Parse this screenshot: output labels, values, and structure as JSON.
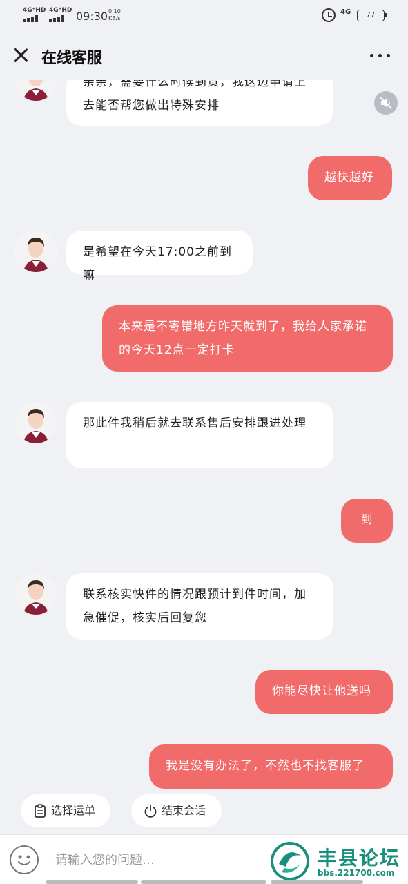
{
  "status_bar": {
    "sig1": "4G⁺HD",
    "sig2": "4G⁺HD",
    "time": "09:30",
    "speed_value": "0.10",
    "speed_unit": "KB/s",
    "network": "4G",
    "battery": "77"
  },
  "header": {
    "title": "在线客服"
  },
  "messages": [
    {
      "from": "agent",
      "text": "亲亲，需要什么时候到货，我这边申请上去能否帮您做出特殊安排"
    },
    {
      "from": "user",
      "text": "越快越好"
    },
    {
      "from": "agent",
      "text": "是希望在今天17:00之前到嘛"
    },
    {
      "from": "user",
      "text": "本来是不寄错地方昨天就到了，我给人家承诺的今天12点一定打卡"
    },
    {
      "from": "agent",
      "text": "那此件我稍后就去联系售后安排跟进处理"
    },
    {
      "from": "user",
      "text": "到"
    },
    {
      "from": "agent",
      "text": "联系核实快件的情况跟预计到件时间，加急催促，核实后回复您"
    },
    {
      "from": "user",
      "text": "你能尽快让他送吗"
    },
    {
      "from": "user",
      "text": "我是没有办法了，不然也不找客服了"
    }
  ],
  "actions": {
    "select_waybill": "选择运单",
    "end_session": "结束会话"
  },
  "input": {
    "placeholder": "请输入您的问题…"
  },
  "watermark": {
    "name": "丰县论坛",
    "url": "bbs.221700.com"
  },
  "icons": {
    "close": "close-icon",
    "more": "more-icon",
    "mute": "speaker-mute-icon",
    "clipboard": "clipboard-icon",
    "power": "power-icon",
    "emoji": "emoji-icon"
  },
  "colors": {
    "user_bubble": "#f26b6b",
    "agent_bubble": "#ffffff",
    "background": "#f0f1f5",
    "watermark": "#1a8f7c"
  }
}
